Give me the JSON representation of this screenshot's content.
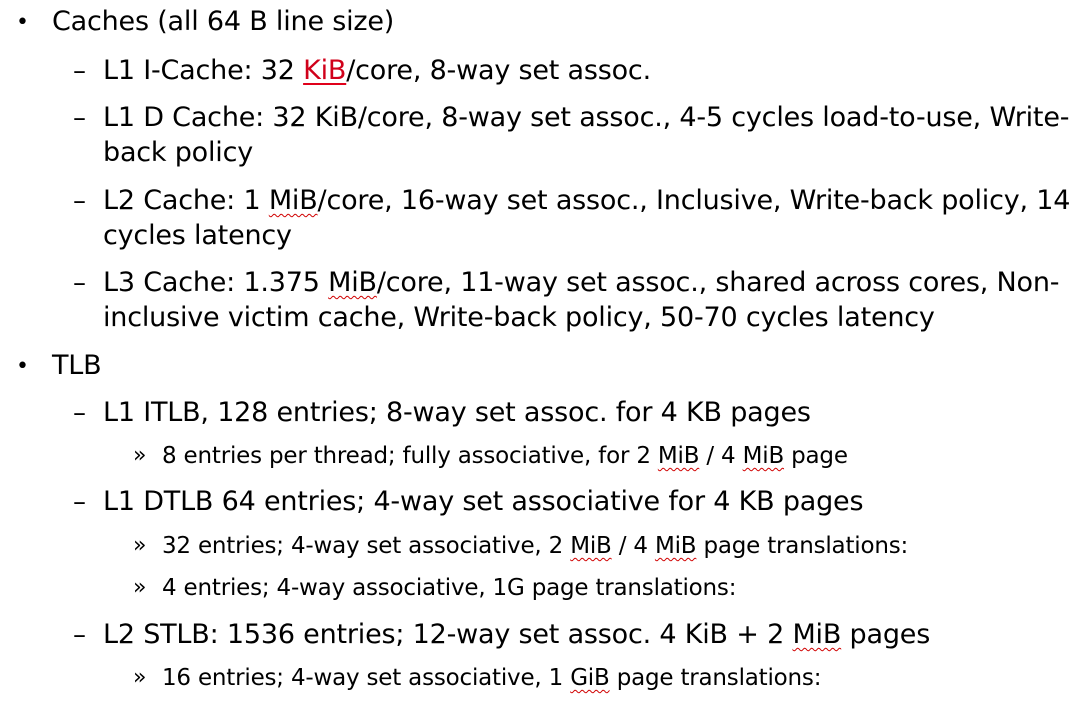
{
  "markers": {
    "bullet": "•",
    "dash": "–",
    "sub": "»"
  },
  "lines": [
    {
      "level": 1,
      "parts": [
        "Caches (all 64 B line size)"
      ]
    },
    {
      "level": 2,
      "parts": [
        "L1 I-Cache: 32 ",
        "KiB",
        "/core, 8-way set assoc."
      ]
    },
    {
      "level": 2,
      "parts": [
        "L1 D Cache: 32 KiB/core, 8-way set assoc.,  4-5 cycles load-to-use, Write-"
      ]
    },
    {
      "level": 2,
      "cont": true,
      "parts": [
        "back policy"
      ]
    },
    {
      "level": 2,
      "parts": [
        "L2 Cache: 1 ",
        "MiB",
        "/core, 16-way set assoc., Inclusive, Write-back policy, 14"
      ]
    },
    {
      "level": 2,
      "cont": true,
      "parts": [
        "cycles latency"
      ]
    },
    {
      "level": 2,
      "parts": [
        "L3 Cache: 1.375 ",
        "MiB",
        "/core, 11-way set assoc., shared across cores, Non-"
      ]
    },
    {
      "level": 2,
      "cont": true,
      "parts": [
        "inclusive victim cache, Write-back policy, 50-70 cycles latency"
      ]
    },
    {
      "level": 1,
      "parts": [
        "TLB"
      ]
    },
    {
      "level": 2,
      "parts": [
        "L1 ITLB, 128 entries; 8-way set assoc. for 4 KB pages"
      ]
    },
    {
      "level": 3,
      "parts": [
        "8 entries per thread; fully associative, for 2 ",
        "MiB",
        " / 4 ",
        "MiB",
        " page"
      ]
    },
    {
      "level": 2,
      "parts": [
        "L1 DTLB 64 entries; 4-way set associative for 4 KB pages"
      ]
    },
    {
      "level": 3,
      "parts": [
        "32 entries; 4-way set associative, 2 ",
        "MiB",
        " / 4 ",
        "MiB",
        " page translations:"
      ]
    },
    {
      "level": 3,
      "parts": [
        "4 entries; 4-way associative, 1G page translations:"
      ]
    },
    {
      "level": 2,
      "parts": [
        "L2 STLB: 1536 entries; 12-way set assoc. 4 KiB + 2 ",
        "MiB",
        " pages"
      ]
    },
    {
      "level": 3,
      "parts": [
        "16 entries; 4-way set associative, 1 ",
        "GiB",
        " page translations:"
      ]
    }
  ]
}
